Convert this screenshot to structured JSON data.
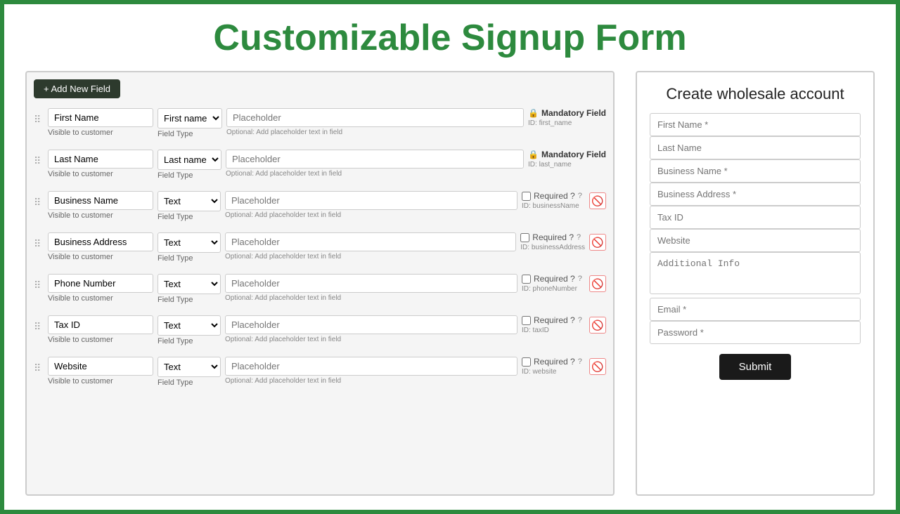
{
  "page": {
    "title": "Customizable Signup Form",
    "border_color": "#2d8a3e"
  },
  "left_panel": {
    "add_button_label": "+ Add New Field",
    "fields": [
      {
        "label": "First Name",
        "visible_text": "Visible to customer",
        "field_type": "First name",
        "field_type_label": "Field Type",
        "placeholder": "Placeholder",
        "placeholder_hint": "Optional: Add placeholder text in field",
        "required_type": "mandatory",
        "required_label": "Mandatory Field",
        "id_label": "ID: first_name"
      },
      {
        "label": "Last Name",
        "visible_text": "Visible to customer",
        "field_type": "Last name",
        "field_type_label": "Field Type",
        "placeholder": "Placeholder",
        "placeholder_hint": "Optional: Add placeholder text in field",
        "required_type": "mandatory",
        "required_label": "Mandatory Field",
        "id_label": "ID: last_name"
      },
      {
        "label": "Business Name",
        "visible_text": "Visible to customer",
        "field_type": "Text",
        "field_type_label": "Field Type",
        "placeholder": "Placeholder",
        "placeholder_hint": "Optional: Add placeholder text in field",
        "required_type": "optional",
        "required_label": "Required ?",
        "id_label": "ID: businessName"
      },
      {
        "label": "Business Address",
        "visible_text": "Visible to customer",
        "field_type": "Text",
        "field_type_label": "Field Type",
        "placeholder": "Placeholder",
        "placeholder_hint": "Optional: Add placeholder text in field",
        "required_type": "optional",
        "required_label": "Required ?",
        "id_label": "ID: businessAddress"
      },
      {
        "label": "Phone Number",
        "visible_text": "Visible to customer",
        "field_type": "Text",
        "field_type_label": "Field Type",
        "placeholder": "Placeholder",
        "placeholder_hint": "Optional: Add placeholder text in field",
        "required_type": "optional",
        "required_label": "Required ?",
        "id_label": "ID: phoneNumber"
      },
      {
        "label": "Tax ID",
        "visible_text": "Visible to customer",
        "field_type": "Text",
        "field_type_label": "Field Type",
        "placeholder": "Placeholder",
        "placeholder_hint": "Optional: Add placeholder text in field",
        "required_type": "optional",
        "required_label": "Required ?",
        "id_label": "ID: taxID"
      },
      {
        "label": "Website",
        "visible_text": "Visible to customer",
        "field_type": "Text",
        "field_type_label": "Field Type",
        "placeholder": "Placeholder",
        "placeholder_hint": "Optional: Add placeholder text in field",
        "required_type": "optional",
        "required_label": "Required ?",
        "id_label": "ID: website"
      }
    ]
  },
  "right_panel": {
    "form_title": "Create wholesale account",
    "fields": [
      {
        "placeholder": "First Name *",
        "type": "input"
      },
      {
        "placeholder": "Last Name",
        "type": "input"
      },
      {
        "placeholder": "Business Name *",
        "type": "input"
      },
      {
        "placeholder": "Business Address *",
        "type": "input"
      },
      {
        "placeholder": "Tax ID",
        "type": "input"
      },
      {
        "placeholder": "Website",
        "type": "input"
      },
      {
        "placeholder": "Additional Info",
        "type": "textarea"
      },
      {
        "placeholder": "Email *",
        "type": "input"
      },
      {
        "placeholder": "Password *",
        "type": "input"
      }
    ],
    "submit_label": "Submit"
  }
}
